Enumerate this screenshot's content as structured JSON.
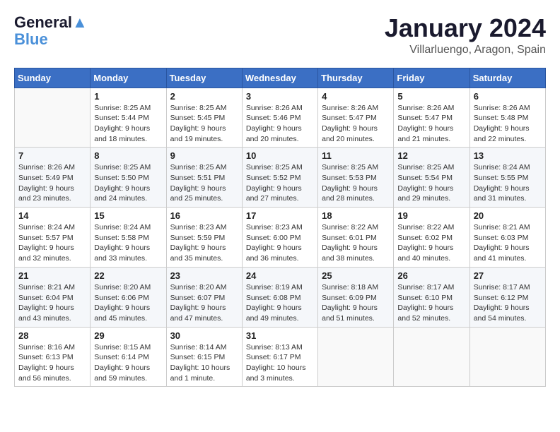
{
  "header": {
    "logo_line1": "General",
    "logo_line2": "Blue",
    "title": "January 2024",
    "subtitle": "Villarluengo, Aragon, Spain"
  },
  "weekdays": [
    "Sunday",
    "Monday",
    "Tuesday",
    "Wednesday",
    "Thursday",
    "Friday",
    "Saturday"
  ],
  "weeks": [
    [
      {
        "day": "",
        "info": ""
      },
      {
        "day": "1",
        "info": "Sunrise: 8:25 AM\nSunset: 5:44 PM\nDaylight: 9 hours\nand 18 minutes."
      },
      {
        "day": "2",
        "info": "Sunrise: 8:25 AM\nSunset: 5:45 PM\nDaylight: 9 hours\nand 19 minutes."
      },
      {
        "day": "3",
        "info": "Sunrise: 8:26 AM\nSunset: 5:46 PM\nDaylight: 9 hours\nand 20 minutes."
      },
      {
        "day": "4",
        "info": "Sunrise: 8:26 AM\nSunset: 5:47 PM\nDaylight: 9 hours\nand 20 minutes."
      },
      {
        "day": "5",
        "info": "Sunrise: 8:26 AM\nSunset: 5:47 PM\nDaylight: 9 hours\nand 21 minutes."
      },
      {
        "day": "6",
        "info": "Sunrise: 8:26 AM\nSunset: 5:48 PM\nDaylight: 9 hours\nand 22 minutes."
      }
    ],
    [
      {
        "day": "7",
        "info": "Sunrise: 8:26 AM\nSunset: 5:49 PM\nDaylight: 9 hours\nand 23 minutes."
      },
      {
        "day": "8",
        "info": "Sunrise: 8:25 AM\nSunset: 5:50 PM\nDaylight: 9 hours\nand 24 minutes."
      },
      {
        "day": "9",
        "info": "Sunrise: 8:25 AM\nSunset: 5:51 PM\nDaylight: 9 hours\nand 25 minutes."
      },
      {
        "day": "10",
        "info": "Sunrise: 8:25 AM\nSunset: 5:52 PM\nDaylight: 9 hours\nand 27 minutes."
      },
      {
        "day": "11",
        "info": "Sunrise: 8:25 AM\nSunset: 5:53 PM\nDaylight: 9 hours\nand 28 minutes."
      },
      {
        "day": "12",
        "info": "Sunrise: 8:25 AM\nSunset: 5:54 PM\nDaylight: 9 hours\nand 29 minutes."
      },
      {
        "day": "13",
        "info": "Sunrise: 8:24 AM\nSunset: 5:55 PM\nDaylight: 9 hours\nand 31 minutes."
      }
    ],
    [
      {
        "day": "14",
        "info": "Sunrise: 8:24 AM\nSunset: 5:57 PM\nDaylight: 9 hours\nand 32 minutes."
      },
      {
        "day": "15",
        "info": "Sunrise: 8:24 AM\nSunset: 5:58 PM\nDaylight: 9 hours\nand 33 minutes."
      },
      {
        "day": "16",
        "info": "Sunrise: 8:23 AM\nSunset: 5:59 PM\nDaylight: 9 hours\nand 35 minutes."
      },
      {
        "day": "17",
        "info": "Sunrise: 8:23 AM\nSunset: 6:00 PM\nDaylight: 9 hours\nand 36 minutes."
      },
      {
        "day": "18",
        "info": "Sunrise: 8:22 AM\nSunset: 6:01 PM\nDaylight: 9 hours\nand 38 minutes."
      },
      {
        "day": "19",
        "info": "Sunrise: 8:22 AM\nSunset: 6:02 PM\nDaylight: 9 hours\nand 40 minutes."
      },
      {
        "day": "20",
        "info": "Sunrise: 8:21 AM\nSunset: 6:03 PM\nDaylight: 9 hours\nand 41 minutes."
      }
    ],
    [
      {
        "day": "21",
        "info": "Sunrise: 8:21 AM\nSunset: 6:04 PM\nDaylight: 9 hours\nand 43 minutes."
      },
      {
        "day": "22",
        "info": "Sunrise: 8:20 AM\nSunset: 6:06 PM\nDaylight: 9 hours\nand 45 minutes."
      },
      {
        "day": "23",
        "info": "Sunrise: 8:20 AM\nSunset: 6:07 PM\nDaylight: 9 hours\nand 47 minutes."
      },
      {
        "day": "24",
        "info": "Sunrise: 8:19 AM\nSunset: 6:08 PM\nDaylight: 9 hours\nand 49 minutes."
      },
      {
        "day": "25",
        "info": "Sunrise: 8:18 AM\nSunset: 6:09 PM\nDaylight: 9 hours\nand 51 minutes."
      },
      {
        "day": "26",
        "info": "Sunrise: 8:17 AM\nSunset: 6:10 PM\nDaylight: 9 hours\nand 52 minutes."
      },
      {
        "day": "27",
        "info": "Sunrise: 8:17 AM\nSunset: 6:12 PM\nDaylight: 9 hours\nand 54 minutes."
      }
    ],
    [
      {
        "day": "28",
        "info": "Sunrise: 8:16 AM\nSunset: 6:13 PM\nDaylight: 9 hours\nand 56 minutes."
      },
      {
        "day": "29",
        "info": "Sunrise: 8:15 AM\nSunset: 6:14 PM\nDaylight: 9 hours\nand 59 minutes."
      },
      {
        "day": "30",
        "info": "Sunrise: 8:14 AM\nSunset: 6:15 PM\nDaylight: 10 hours\nand 1 minute."
      },
      {
        "day": "31",
        "info": "Sunrise: 8:13 AM\nSunset: 6:17 PM\nDaylight: 10 hours\nand 3 minutes."
      },
      {
        "day": "",
        "info": ""
      },
      {
        "day": "",
        "info": ""
      },
      {
        "day": "",
        "info": ""
      }
    ]
  ]
}
